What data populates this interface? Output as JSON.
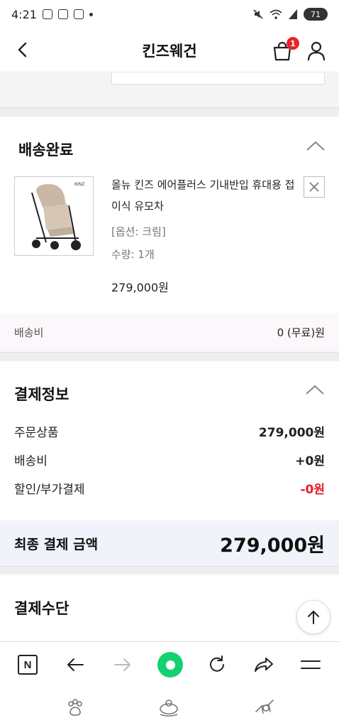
{
  "status_bar": {
    "time": "4:21",
    "battery": "71"
  },
  "header": {
    "title": "킨즈웨건",
    "cart_count": "1"
  },
  "delivery_section": {
    "title": "배송완료",
    "product": {
      "name": "올뉴 킨즈 에어플러스 기내반입 휴대용 접이식 유모차",
      "option": "[옵션: 크림]",
      "quantity": "수량: 1개",
      "price": "279,000원"
    },
    "shipping_label": "배송비",
    "shipping_value": "0 (무료)원"
  },
  "payment_info": {
    "title": "결제정보",
    "rows": [
      {
        "label": "주문상품",
        "value": "279,000원"
      },
      {
        "label": "배송비",
        "value": "+0원"
      },
      {
        "label": "할인/부가결제",
        "value": "-0원"
      }
    ],
    "final_label": "최종 결제 금액",
    "final_value": "279,000원"
  },
  "payment_method": {
    "title": "결제수단"
  },
  "icons": {
    "back": "back-arrow-icon",
    "cart": "shopping-bag-icon",
    "user": "user-icon",
    "collapse": "chevron-up-icon",
    "remove": "close-icon",
    "scroll_top": "arrow-up-icon",
    "browser": [
      "naver-logo-icon",
      "back-arrow-icon",
      "forward-arrow-icon",
      "green-dot-icon",
      "refresh-icon",
      "share-icon",
      "menu-icon"
    ],
    "system": [
      "paw-icon",
      "toy-icon",
      "animal-icon"
    ]
  },
  "colors": {
    "accent_red": "#e0202a",
    "badge_red": "#e8242b",
    "green": "#14d170"
  }
}
